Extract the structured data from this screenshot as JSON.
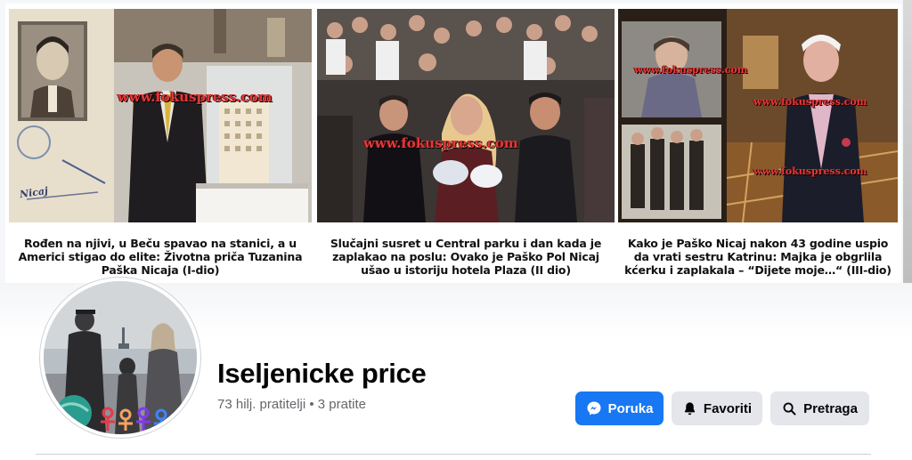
{
  "cover": {
    "panels": [
      {
        "caption": "Rođen na njivi, u Beču spavao na stanici, a u Americi stigao do elite: Životna priča Tuzanina Paška Nicaja (I-dio)",
        "watermark": "www.fokuspress.com",
        "passport_text": "Nicaj"
      },
      {
        "caption": "Slučajni susret u Central parku i dan kada je zaplakao na poslu: Ovako je Paško Pol Nicaj ušao u istoriju hotela Plaza (II dio)",
        "watermark": "www.fokuspress.com"
      },
      {
        "caption": "Kako je Paško Nicaj nakon 43 godine uspio da vrati sestru Katrinu: Majka je obgrlila kćerku i zaplakala – “Dijete moje…“ (III-dio)",
        "watermark": "www.fokuspress.com"
      }
    ]
  },
  "page": {
    "name": "Iseljenicke price",
    "stats": "73 hilj. pratitelji • 3 pratite"
  },
  "actions": {
    "message": {
      "label": "Poruka",
      "icon": "messenger-icon"
    },
    "favorites": {
      "label": "Favoriti",
      "icon": "bell-icon"
    },
    "search": {
      "label": "Pretraga",
      "icon": "search-icon"
    }
  },
  "colors": {
    "primary": "#1877f2",
    "secondary": "#e4e6eb",
    "muted_text": "#65676b",
    "watermark": "#e23838"
  }
}
